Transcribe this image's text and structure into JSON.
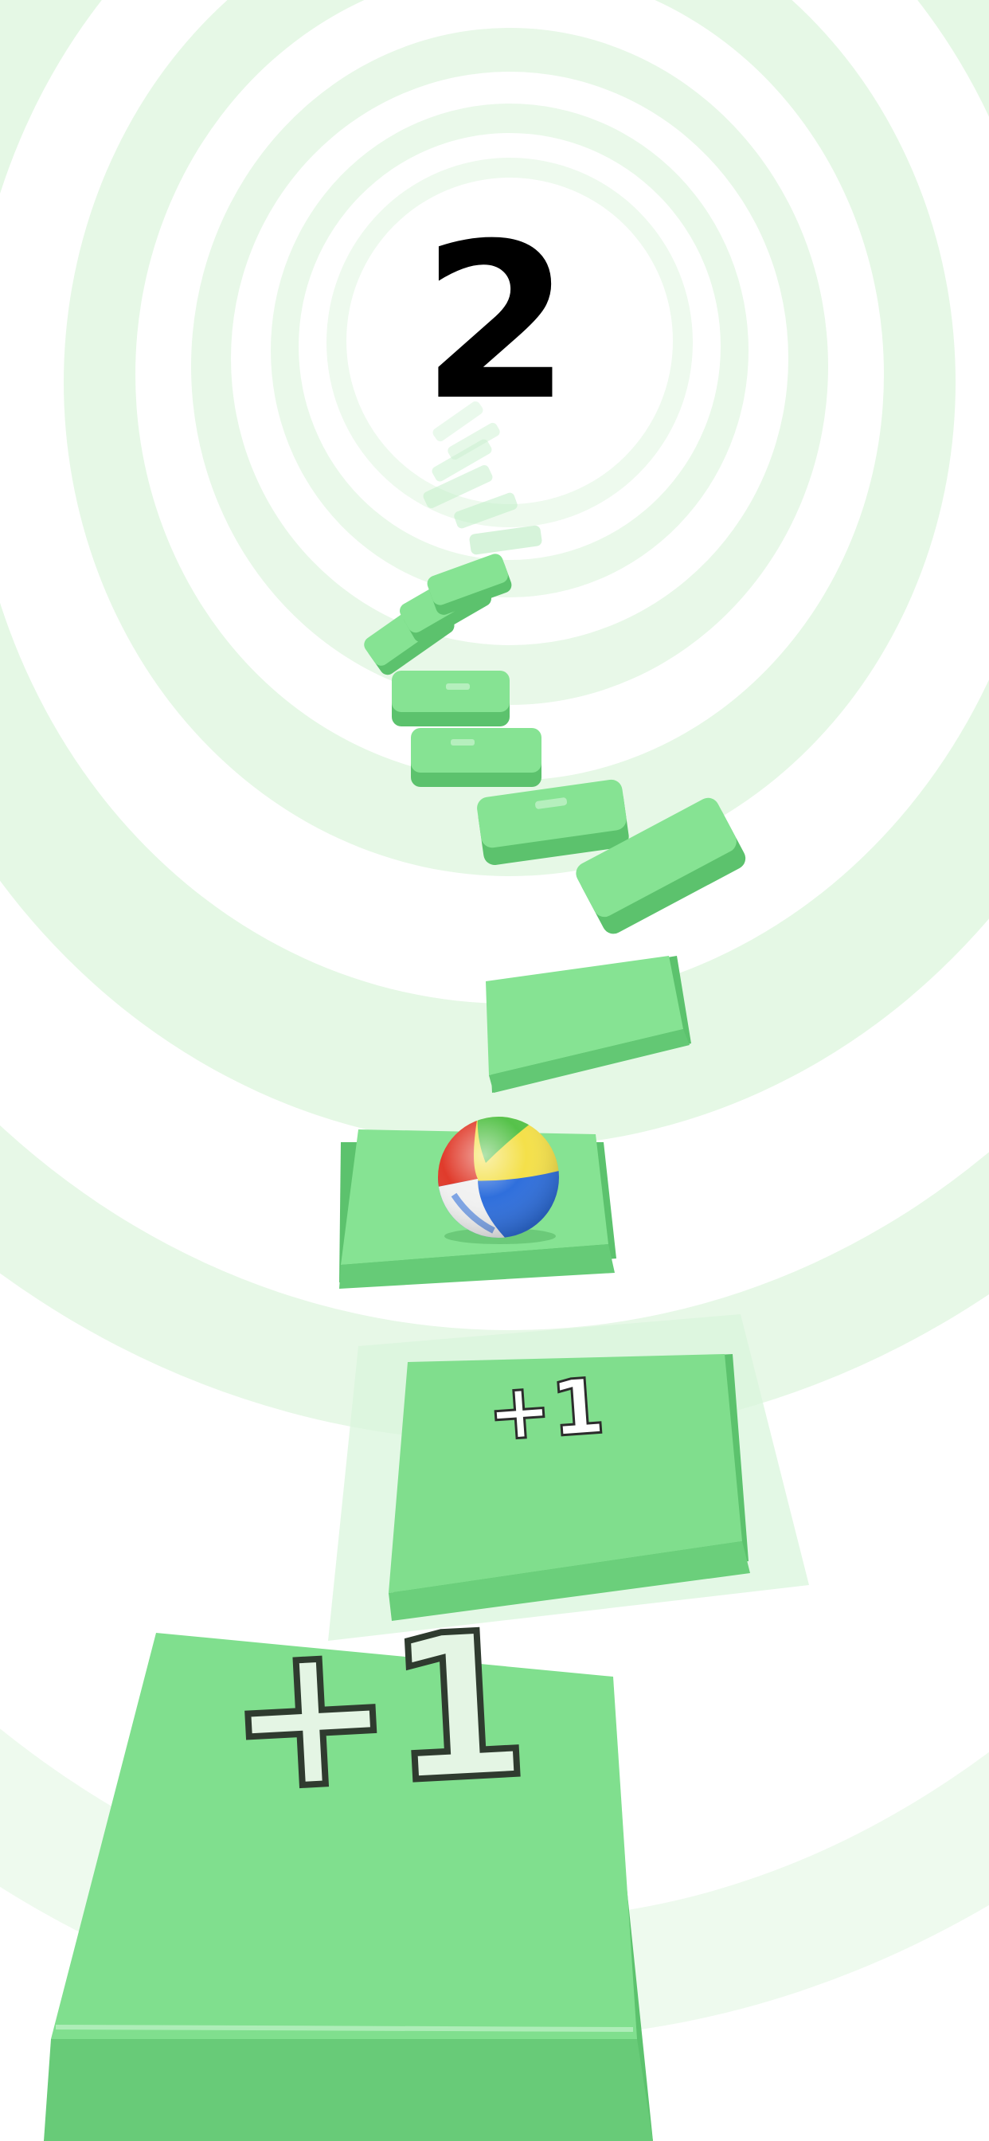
{
  "game": {
    "score": "2",
    "popups": [
      "+1",
      "+1"
    ],
    "colors": {
      "background": "#ffffff",
      "ring": "#e6f8e6",
      "tile_top": "#80df8e",
      "tile_side": "#5cc26d",
      "tile_edge": "#a6eab0",
      "score_text": "#000000"
    },
    "ball": {
      "colors": [
        "#f4e04a",
        "#2f6fdc",
        "#e03b2b",
        "#56c24a",
        "#f1f1f1"
      ]
    }
  }
}
